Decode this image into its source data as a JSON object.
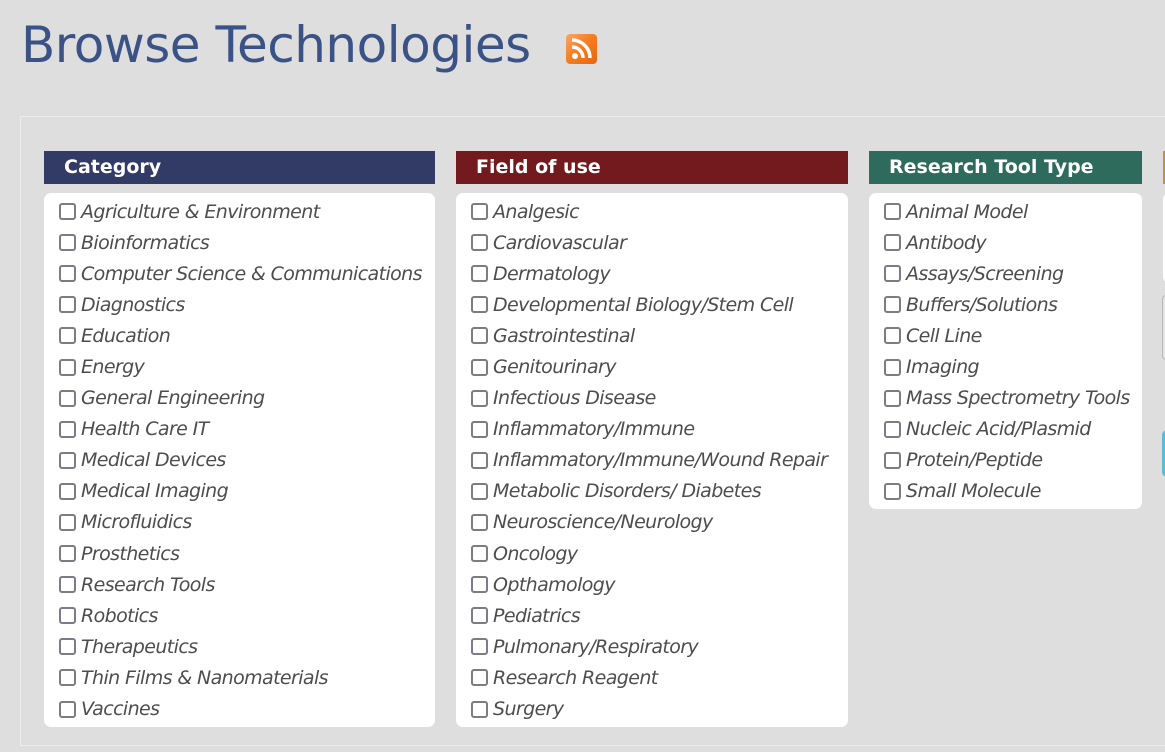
{
  "page": {
    "title": "Browse Technologies",
    "rss_icon": "rss-feed-icon"
  },
  "facets": {
    "category": {
      "header": "Category",
      "color": "#323a66",
      "items": [
        {
          "label": "Agriculture & Environment",
          "checked": false
        },
        {
          "label": "Bioinformatics",
          "checked": false
        },
        {
          "label": "Computer Science & Communications",
          "checked": false
        },
        {
          "label": "Diagnostics",
          "checked": false
        },
        {
          "label": "Education",
          "checked": false
        },
        {
          "label": "Energy",
          "checked": false
        },
        {
          "label": "General Engineering",
          "checked": false
        },
        {
          "label": "Health Care IT",
          "checked": false
        },
        {
          "label": "Medical Devices",
          "checked": false
        },
        {
          "label": "Medical Imaging",
          "checked": false
        },
        {
          "label": "Microfluidics",
          "checked": false
        },
        {
          "label": "Prosthetics",
          "checked": false
        },
        {
          "label": "Research Tools",
          "checked": false
        },
        {
          "label": "Robotics",
          "checked": false
        },
        {
          "label": "Therapeutics",
          "checked": false
        },
        {
          "label": "Thin Films & Nanomaterials",
          "checked": false
        },
        {
          "label": "Vaccines",
          "checked": false
        }
      ]
    },
    "field_of_use": {
      "header": "Field of use",
      "color": "#731a1e",
      "items": [
        {
          "label": "Analgesic",
          "checked": false
        },
        {
          "label": "Cardiovascular",
          "checked": false
        },
        {
          "label": "Dermatology",
          "checked": false
        },
        {
          "label": "Developmental Biology/Stem Cell",
          "checked": false
        },
        {
          "label": "Gastrointestinal",
          "checked": false
        },
        {
          "label": "Genitourinary",
          "checked": false
        },
        {
          "label": "Infectious Disease",
          "checked": false
        },
        {
          "label": "Inflammatory/Immune",
          "checked": false
        },
        {
          "label": "Inflammatory/Immune/Wound Repair",
          "checked": false
        },
        {
          "label": "Metabolic Disorders/ Diabetes",
          "checked": false
        },
        {
          "label": "Neuroscience/Neurology",
          "checked": false
        },
        {
          "label": "Oncology",
          "checked": false
        },
        {
          "label": "Opthamology",
          "checked": false
        },
        {
          "label": "Pediatrics",
          "checked": false
        },
        {
          "label": "Pulmonary/Respiratory",
          "checked": false
        },
        {
          "label": "Research Reagent",
          "checked": false
        },
        {
          "label": "Surgery",
          "checked": false
        }
      ]
    },
    "research_tool_type": {
      "header": "Research Tool Type",
      "color": "#2e6b5c",
      "items": [
        {
          "label": "Animal Model",
          "checked": false
        },
        {
          "label": "Antibody",
          "checked": false
        },
        {
          "label": "Assays/Screening",
          "checked": false
        },
        {
          "label": "Buffers/Solutions",
          "checked": false
        },
        {
          "label": "Cell Line",
          "checked": false
        },
        {
          "label": "Imaging",
          "checked": false
        },
        {
          "label": "Mass Spectrometry Tools",
          "checked": false
        },
        {
          "label": "Nucleic Acid/Plasmid",
          "checked": false
        },
        {
          "label": "Protein/Peptide",
          "checked": false
        },
        {
          "label": "Small Molecule",
          "checked": false
        }
      ]
    },
    "partial_next_facet": {
      "color": "#c8922c"
    }
  }
}
